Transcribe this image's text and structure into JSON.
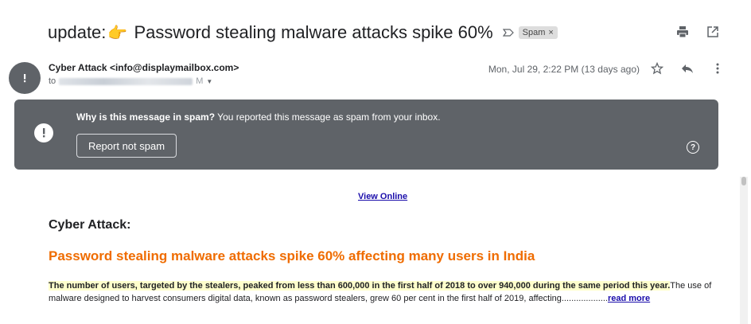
{
  "subject": {
    "prefix": "update:",
    "pointer_emoji": "👉",
    "title": "Password stealing malware attacks spike 60%",
    "label": "Spam",
    "label_remove": "×"
  },
  "actions": {
    "print_icon": "print-icon",
    "popout_icon": "open-in-new-icon",
    "star_icon": "star-icon",
    "reply_icon": "reply-icon",
    "more_icon": "more-vertical-icon"
  },
  "message": {
    "sender_name": "Cyber Attack",
    "sender_email": "<info@displaymailbox.com>",
    "to_prefix": "to",
    "to_suffix": "M",
    "date": "Mon, Jul 29, 2:22 PM (13 days ago)"
  },
  "spam_banner": {
    "title_bold": "Why is this message in spam?",
    "title_rest": " You reported this message as spam from your inbox.",
    "button": "Report not spam",
    "help": "?"
  },
  "email_body": {
    "view_online": "View Online",
    "heading": "Cyber Attack:",
    "headline": "Password stealing malware attacks spike 60% affecting many users in India",
    "highlight": "The number of users, targeted by the stealers, peaked from less than 600,000 in the first half of 2018 to over 940,000 during the same period this year.",
    "rest": "The use of malware designed to harvest consumers digital data, known as password stealers, grew 60 per cent in the first half of 2019, affecting...................",
    "read_more": "read more"
  },
  "colors": {
    "banner": "#5f6368",
    "headline": "#ef6c00",
    "link": "#1a0dab",
    "highlight": "#ffffcc"
  }
}
